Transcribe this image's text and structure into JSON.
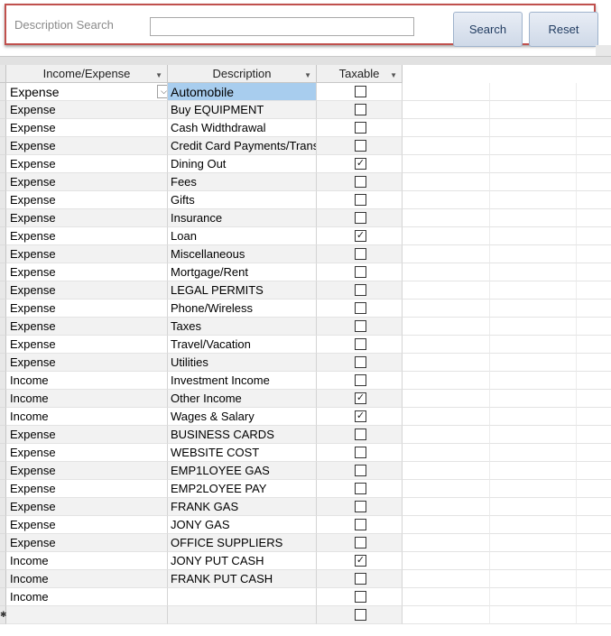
{
  "search": {
    "label": "Description Search",
    "value": "",
    "placeholder": "",
    "search_button": "Search",
    "reset_button": "Reset"
  },
  "columns": [
    "Income/Expense",
    "Description",
    "Taxable"
  ],
  "rows": [
    {
      "type": "Expense",
      "description": "Automobile",
      "taxable": false
    },
    {
      "type": "Expense",
      "description": "Buy EQUIPMENT",
      "taxable": false
    },
    {
      "type": "Expense",
      "description": "Cash Widthdrawal",
      "taxable": false
    },
    {
      "type": "Expense",
      "description": "Credit Card Payments/Transfers",
      "taxable": false
    },
    {
      "type": "Expense",
      "description": "Dining Out",
      "taxable": true
    },
    {
      "type": "Expense",
      "description": "Fees",
      "taxable": false
    },
    {
      "type": "Expense",
      "description": "Gifts",
      "taxable": false
    },
    {
      "type": "Expense",
      "description": "Insurance",
      "taxable": false
    },
    {
      "type": "Expense",
      "description": "Loan",
      "taxable": true
    },
    {
      "type": "Expense",
      "description": "Miscellaneous",
      "taxable": false
    },
    {
      "type": "Expense",
      "description": "Mortgage/Rent",
      "taxable": false
    },
    {
      "type": "Expense",
      "description": "LEGAL PERMITS",
      "taxable": false
    },
    {
      "type": "Expense",
      "description": "Phone/Wireless",
      "taxable": false
    },
    {
      "type": "Expense",
      "description": "Taxes",
      "taxable": false
    },
    {
      "type": "Expense",
      "description": "Travel/Vacation",
      "taxable": false
    },
    {
      "type": "Expense",
      "description": "Utilities",
      "taxable": false
    },
    {
      "type": "Income",
      "description": "Investment Income",
      "taxable": false
    },
    {
      "type": "Income",
      "description": "Other Income",
      "taxable": true
    },
    {
      "type": "Income",
      "description": "Wages & Salary",
      "taxable": true
    },
    {
      "type": "Expense",
      "description": "BUSINESS CARDS",
      "taxable": false
    },
    {
      "type": "Expense",
      "description": "WEBSITE COST",
      "taxable": false
    },
    {
      "type": "Expense",
      "description": "EMP1LOYEE GAS",
      "taxable": false
    },
    {
      "type": "Expense",
      "description": "EMP2LOYEE PAY",
      "taxable": false
    },
    {
      "type": "Expense",
      "description": "FRANK GAS",
      "taxable": false
    },
    {
      "type": "Expense",
      "description": "JONY GAS",
      "taxable": false
    },
    {
      "type": "Expense",
      "description": "OFFICE SUPPLIERS",
      "taxable": false
    },
    {
      "type": "Income",
      "description": "JONY PUT CASH",
      "taxable": true
    },
    {
      "type": "Income",
      "description": "FRANK PUT CASH",
      "taxable": false
    },
    {
      "type": "Income",
      "description": "",
      "taxable": false
    },
    {
      "type": "",
      "description": "",
      "taxable": false,
      "new_record": true
    }
  ],
  "icons": {
    "dropdown": "chevron-down-icon",
    "sort": "sort-arrow-icon",
    "check": "checkmark-icon",
    "new_record": "asterisk-icon"
  },
  "colors": {
    "frame_border": "#c0504d",
    "selected_cell": "#a8cdee",
    "alt_row": "#f2f2f2"
  }
}
